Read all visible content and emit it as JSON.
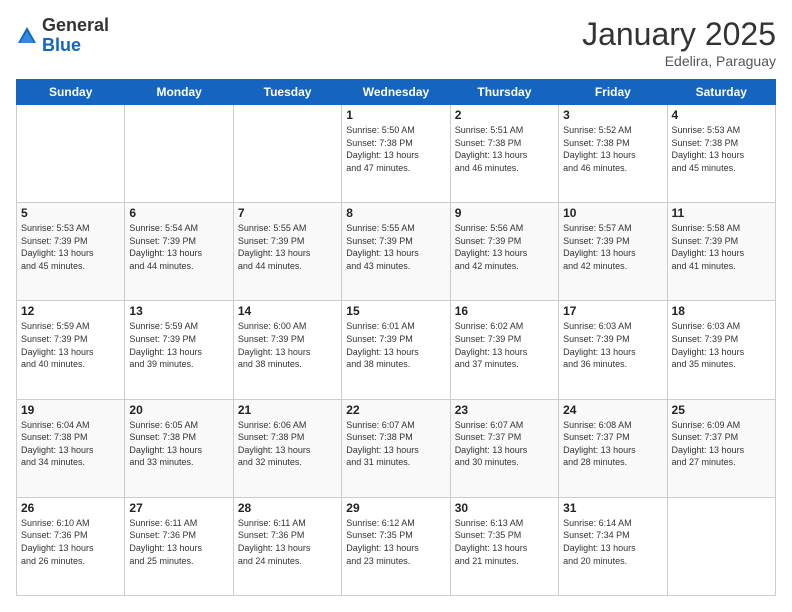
{
  "logo": {
    "general": "General",
    "blue": "Blue"
  },
  "header": {
    "month": "January 2025",
    "location": "Edelira, Paraguay"
  },
  "days": [
    "Sunday",
    "Monday",
    "Tuesday",
    "Wednesday",
    "Thursday",
    "Friday",
    "Saturday"
  ],
  "weeks": [
    [
      {
        "day": "",
        "info": ""
      },
      {
        "day": "",
        "info": ""
      },
      {
        "day": "",
        "info": ""
      },
      {
        "day": "1",
        "info": "Sunrise: 5:50 AM\nSunset: 7:38 PM\nDaylight: 13 hours\nand 47 minutes."
      },
      {
        "day": "2",
        "info": "Sunrise: 5:51 AM\nSunset: 7:38 PM\nDaylight: 13 hours\nand 46 minutes."
      },
      {
        "day": "3",
        "info": "Sunrise: 5:52 AM\nSunset: 7:38 PM\nDaylight: 13 hours\nand 46 minutes."
      },
      {
        "day": "4",
        "info": "Sunrise: 5:53 AM\nSunset: 7:38 PM\nDaylight: 13 hours\nand 45 minutes."
      }
    ],
    [
      {
        "day": "5",
        "info": "Sunrise: 5:53 AM\nSunset: 7:39 PM\nDaylight: 13 hours\nand 45 minutes."
      },
      {
        "day": "6",
        "info": "Sunrise: 5:54 AM\nSunset: 7:39 PM\nDaylight: 13 hours\nand 44 minutes."
      },
      {
        "day": "7",
        "info": "Sunrise: 5:55 AM\nSunset: 7:39 PM\nDaylight: 13 hours\nand 44 minutes."
      },
      {
        "day": "8",
        "info": "Sunrise: 5:55 AM\nSunset: 7:39 PM\nDaylight: 13 hours\nand 43 minutes."
      },
      {
        "day": "9",
        "info": "Sunrise: 5:56 AM\nSunset: 7:39 PM\nDaylight: 13 hours\nand 42 minutes."
      },
      {
        "day": "10",
        "info": "Sunrise: 5:57 AM\nSunset: 7:39 PM\nDaylight: 13 hours\nand 42 minutes."
      },
      {
        "day": "11",
        "info": "Sunrise: 5:58 AM\nSunset: 7:39 PM\nDaylight: 13 hours\nand 41 minutes."
      }
    ],
    [
      {
        "day": "12",
        "info": "Sunrise: 5:59 AM\nSunset: 7:39 PM\nDaylight: 13 hours\nand 40 minutes."
      },
      {
        "day": "13",
        "info": "Sunrise: 5:59 AM\nSunset: 7:39 PM\nDaylight: 13 hours\nand 39 minutes."
      },
      {
        "day": "14",
        "info": "Sunrise: 6:00 AM\nSunset: 7:39 PM\nDaylight: 13 hours\nand 38 minutes."
      },
      {
        "day": "15",
        "info": "Sunrise: 6:01 AM\nSunset: 7:39 PM\nDaylight: 13 hours\nand 38 minutes."
      },
      {
        "day": "16",
        "info": "Sunrise: 6:02 AM\nSunset: 7:39 PM\nDaylight: 13 hours\nand 37 minutes."
      },
      {
        "day": "17",
        "info": "Sunrise: 6:03 AM\nSunset: 7:39 PM\nDaylight: 13 hours\nand 36 minutes."
      },
      {
        "day": "18",
        "info": "Sunrise: 6:03 AM\nSunset: 7:39 PM\nDaylight: 13 hours\nand 35 minutes."
      }
    ],
    [
      {
        "day": "19",
        "info": "Sunrise: 6:04 AM\nSunset: 7:38 PM\nDaylight: 13 hours\nand 34 minutes."
      },
      {
        "day": "20",
        "info": "Sunrise: 6:05 AM\nSunset: 7:38 PM\nDaylight: 13 hours\nand 33 minutes."
      },
      {
        "day": "21",
        "info": "Sunrise: 6:06 AM\nSunset: 7:38 PM\nDaylight: 13 hours\nand 32 minutes."
      },
      {
        "day": "22",
        "info": "Sunrise: 6:07 AM\nSunset: 7:38 PM\nDaylight: 13 hours\nand 31 minutes."
      },
      {
        "day": "23",
        "info": "Sunrise: 6:07 AM\nSunset: 7:37 PM\nDaylight: 13 hours\nand 30 minutes."
      },
      {
        "day": "24",
        "info": "Sunrise: 6:08 AM\nSunset: 7:37 PM\nDaylight: 13 hours\nand 28 minutes."
      },
      {
        "day": "25",
        "info": "Sunrise: 6:09 AM\nSunset: 7:37 PM\nDaylight: 13 hours\nand 27 minutes."
      }
    ],
    [
      {
        "day": "26",
        "info": "Sunrise: 6:10 AM\nSunset: 7:36 PM\nDaylight: 13 hours\nand 26 minutes."
      },
      {
        "day": "27",
        "info": "Sunrise: 6:11 AM\nSunset: 7:36 PM\nDaylight: 13 hours\nand 25 minutes."
      },
      {
        "day": "28",
        "info": "Sunrise: 6:11 AM\nSunset: 7:36 PM\nDaylight: 13 hours\nand 24 minutes."
      },
      {
        "day": "29",
        "info": "Sunrise: 6:12 AM\nSunset: 7:35 PM\nDaylight: 13 hours\nand 23 minutes."
      },
      {
        "day": "30",
        "info": "Sunrise: 6:13 AM\nSunset: 7:35 PM\nDaylight: 13 hours\nand 21 minutes."
      },
      {
        "day": "31",
        "info": "Sunrise: 6:14 AM\nSunset: 7:34 PM\nDaylight: 13 hours\nand 20 minutes."
      },
      {
        "day": "",
        "info": ""
      }
    ]
  ]
}
